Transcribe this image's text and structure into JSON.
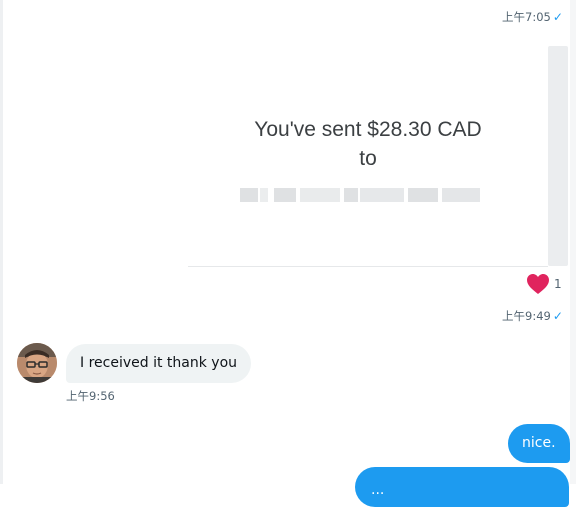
{
  "conversation": {
    "messages": [
      {
        "direction": "outgoing",
        "timestamp": "上午7:05",
        "read_status": "✓"
      },
      {
        "direction": "outgoing",
        "type": "image",
        "image_lines": [
          "You've sent $28.30 CAD",
          "to"
        ],
        "reaction": {
          "icon": "heart-icon",
          "count": "1"
        },
        "timestamp": "上午9:49",
        "read_status": "✓"
      },
      {
        "direction": "incoming",
        "text": "I received it thank you",
        "timestamp": "上午9:56"
      },
      {
        "direction": "outgoing",
        "text": "nice."
      },
      {
        "direction": "outgoing",
        "text": "...",
        "partially_visible": true
      }
    ]
  },
  "colors": {
    "outgoing_bubble": "#1d9bf0",
    "incoming_bubble": "#eff3f4",
    "read_check": "#1d9bf0",
    "reaction_heart": "#e0245e",
    "timestamp": "#536471"
  }
}
